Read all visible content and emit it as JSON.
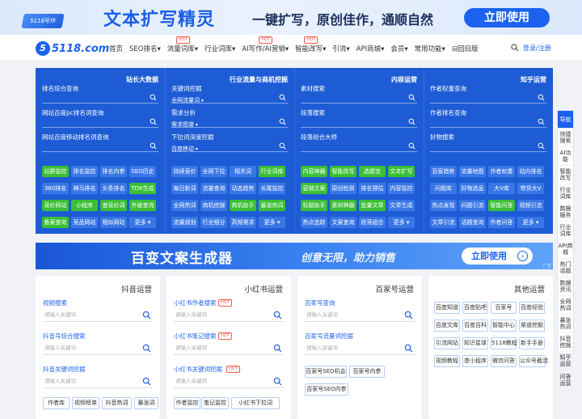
{
  "banner": {
    "badge": "5118写作",
    "headline": "文本扩写精灵",
    "tagline": "一键扩写，原创佳作，通顺自然",
    "cta": "立即使用"
  },
  "nav": {
    "logo_mark": "5",
    "logo_text": "5118.com",
    "hot_label": "HOT",
    "items": [
      {
        "label": "首页",
        "hot": false
      },
      {
        "label": "SEO排名▾",
        "hot": false
      },
      {
        "label": "流量词库▾",
        "hot": true
      },
      {
        "label": "行业词库▾",
        "hot": false
      },
      {
        "label": "AI写作/AI营销▾",
        "hot": true
      },
      {
        "label": "智能改写▾",
        "hot": true
      },
      {
        "label": "引流▾",
        "hot": false
      },
      {
        "label": "API商城▾",
        "hot": false
      },
      {
        "label": "会员▾",
        "hot": false
      },
      {
        "label": "常用功能▾",
        "hot": false
      },
      {
        "label": "⊟回旧版",
        "hot": false
      }
    ],
    "login": "登录/注册"
  },
  "tools": {
    "columns": [
      {
        "title": "站长大数据",
        "fields": [
          {
            "label": "排名综合查询"
          },
          {
            "label": "网站百度pc排名词查询"
          },
          {
            "label": "网站百度移动排名词查询"
          }
        ],
        "buttons": [
          [
            "站群监控",
            "排名监控",
            "排名内参",
            "SEO历史"
          ],
          [
            "360排名",
            "神马排名",
            "头条排名",
            "TDK生成"
          ],
          [
            "竞价网站",
            "小程序",
            "查竞价词",
            "外链查询"
          ],
          [
            "备案查询",
            "竞品网站",
            "相似网站",
            "更多"
          ]
        ]
      },
      {
        "title": "行业流量与商机挖掘",
        "fields": [
          {
            "label": "关键词挖掘",
            "select": "全网流量词"
          },
          {
            "label": "需求分析",
            "select": "需求图谱"
          },
          {
            "label": "下拉词深度挖掘",
            "select": "百度移动"
          }
        ],
        "buttons": [
          [
            "持续竞价",
            "全网下拉",
            "相关词",
            "行业词库"
          ],
          [
            "每日新词",
            "流量查询",
            "动态趋势",
            "长尾监控"
          ],
          [
            "全网热词",
            "商机挖掘",
            "商机助手",
            "暴涨热词"
          ],
          [
            "流量规划",
            "行业细分",
            "高频需求",
            "更多"
          ]
        ]
      },
      {
        "title": "内容运营",
        "fields": [
          {
            "label": "素材搜索"
          },
          {
            "label": "段落搜索"
          },
          {
            "label": "段落组合大师"
          }
        ],
        "buttons": [
          [
            "内容神器",
            "智能改写",
            "选题宝",
            "文本扩写"
          ],
          [
            "营销文案",
            "原创检测",
            "排名预估",
            "内容监控"
          ],
          [
            "标题助手",
            "素材神器",
            "批量文章",
            "文章生成"
          ],
          [
            "热点追踪",
            "文案查询",
            "段落组合",
            "更多"
          ]
        ]
      },
      {
        "title": "知乎运营",
        "fields": [
          {
            "label": "作者权重查询"
          },
          {
            "label": "作者排名查询"
          },
          {
            "label": "好物搜索"
          }
        ],
        "buttons": [
          [
            "百家趋势",
            "流量地图",
            "作者权重",
            "站内排名"
          ],
          [
            "问题库",
            "好物选品",
            "大V库",
            "带货大V"
          ],
          [
            "热点发现",
            "问题引流",
            "智能问答",
            "视频引流"
          ],
          [
            "文章引流",
            "话题查询",
            "作者问答",
            "更多"
          ]
        ]
      }
    ]
  },
  "ad": {
    "headline": "百变文案生成器",
    "sub": "创意无限，助力销售",
    "cta": "立即使用",
    "arrow": "›",
    "tag": "广告"
  },
  "cards": [
    {
      "title": "抖音运营",
      "items": [
        {
          "label": "视频搜索",
          "placeholder": "请输入关键词",
          "hot": false
        },
        {
          "label": "抖音号综合搜索",
          "placeholder": "请输入关键词",
          "hot": false
        },
        {
          "label": "抖音关键词挖掘",
          "placeholder": "请输入关键词",
          "hot": false
        }
      ],
      "buttons": [
        "作者库",
        "视频榜单",
        "抖音热词",
        "暴涨词"
      ]
    },
    {
      "title": "小红书运营",
      "items": [
        {
          "label": "小红书作者搜索",
          "placeholder": "请输入关键词",
          "hot": true
        },
        {
          "label": "小红书笔记搜索",
          "placeholder": "请输入关键词",
          "hot": true
        },
        {
          "label": "小红书关键词挖掘",
          "placeholder": "请输入关键词",
          "hot": true
        }
      ],
      "buttons": [
        "作者监控",
        "笔记监控",
        "小红书下拉词"
      ]
    },
    {
      "title": "百家号运营",
      "items": [
        {
          "label": "百家号查询",
          "placeholder": "请输入关键词",
          "hot": false
        },
        {
          "label": "百家号流量词挖掘",
          "placeholder": "请输入关键词",
          "hot": false
        }
      ],
      "buttons": [
        "百家号SEO机会",
        "百家号内参",
        "百家号SEO内参"
      ]
    },
    {
      "title": "其他运营",
      "buttons": [
        "百度知道",
        "百度贴吧",
        "百家号",
        "百度经验",
        "百度文库",
        "百度百科",
        "智能中心",
        "渠道挖掘",
        "引流网站",
        "知识星球",
        "5118教程",
        "新手手册",
        "视频教程",
        "查小程序",
        "微信问答",
        "公众号截流"
      ]
    }
  ],
  "hot_label": "HOT",
  "sidebar": [
    "导航",
    "快捷搜索",
    "AI功能",
    "智能改写",
    "行业词库",
    "数据服务",
    "行业词库",
    "API商城",
    "热门话题",
    "数据资讯",
    "全网热词",
    "暴涨热词",
    "抖音挖掘",
    "知乎运营",
    "问答运营"
  ]
}
